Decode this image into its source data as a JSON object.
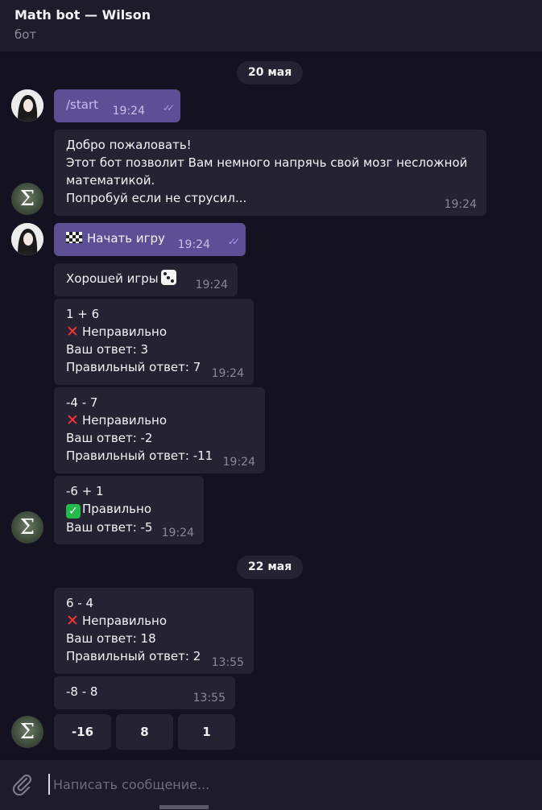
{
  "header": {
    "title": "Math bot — Wilson",
    "subtitle": "бот"
  },
  "dates": [
    "20 мая",
    "22 мая"
  ],
  "messages": [
    {
      "lines": [
        "/start"
      ],
      "time": "19:24",
      "outgoing": true
    },
    {
      "lines": [
        "Добро пожаловать!",
        "Этот бот позволит Вам немного напрячь свой мозг несложной",
        "математикой.",
        "Попробуй если не струсил..."
      ],
      "time": "19:24"
    },
    {
      "lines": [
        "Начать игру"
      ],
      "time": "19:24",
      "outgoing": true,
      "icon": "chequered-flag-icon"
    },
    {
      "lines": [
        "Хорошей игры"
      ],
      "time": "19:24",
      "icon": "dice-icon"
    },
    {
      "lines": [
        "1 + 6",
        "Неправильно",
        "Ваш ответ: 3",
        "Правильный ответ: 7"
      ],
      "time": "19:24"
    },
    {
      "lines": [
        "-4 - 7",
        "Неправильно",
        "Ваш ответ: -2",
        "Правильный ответ: -11"
      ],
      "time": "19:24"
    },
    {
      "lines": [
        "-6 + 1",
        "Правильно",
        "Ваш ответ: -5"
      ],
      "time": "19:24"
    },
    {
      "lines": [
        "6 - 4",
        "Неправильно",
        "Ваш ответ: 18",
        "Правильный ответ: 2"
      ],
      "time": "13:55"
    },
    {
      "lines": [
        "-8 - 8"
      ],
      "time": "13:55"
    }
  ],
  "keyboard": [
    "-16",
    "8",
    "1"
  ],
  "composer": {
    "placeholder": "Написать сообщение..."
  },
  "icons": {
    "wrong": "cross-mark-icon",
    "correct": "check-mark-icon",
    "attach": "paperclip-icon",
    "bot_avatar": "sigma-icon"
  },
  "colors": {
    "background": "#141220",
    "bubble_in": "#252333",
    "bubble_out": "#5d4f96",
    "accent": "#a99bf0"
  }
}
